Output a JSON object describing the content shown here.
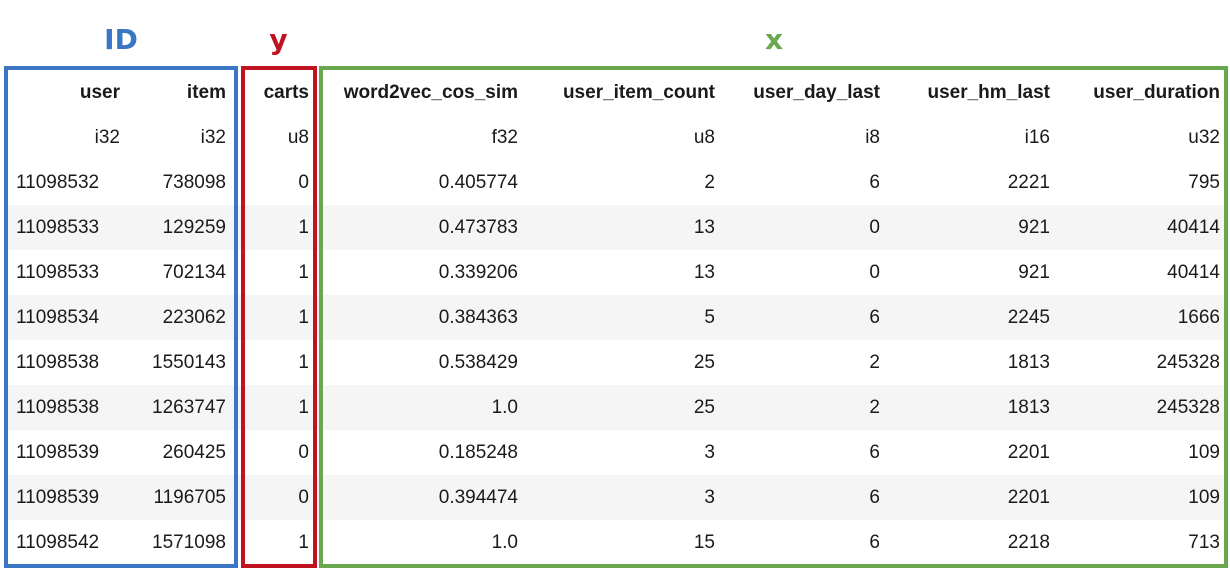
{
  "groups": {
    "id": {
      "label": "ID",
      "color": "#3a76c4"
    },
    "y": {
      "label": "y",
      "color": "#c1121f"
    },
    "x": {
      "label": "x",
      "color": "#6aa84f"
    }
  },
  "columns": [
    "user",
    "item",
    "carts",
    "word2vec_cos_sim",
    "user_item_count",
    "user_day_last",
    "user_hm_last",
    "user_duration"
  ],
  "dtypes": [
    "i32",
    "i32",
    "u8",
    "f32",
    "u8",
    "i8",
    "i16",
    "u32"
  ],
  "rows": [
    [
      "11098532",
      "738098",
      "0",
      "0.405774",
      "2",
      "6",
      "2221",
      "795"
    ],
    [
      "11098533",
      "129259",
      "1",
      "0.473783",
      "13",
      "0",
      "921",
      "40414"
    ],
    [
      "11098533",
      "702134",
      "1",
      "0.339206",
      "13",
      "0",
      "921",
      "40414"
    ],
    [
      "11098534",
      "223062",
      "1",
      "0.384363",
      "5",
      "6",
      "2245",
      "1666"
    ],
    [
      "11098538",
      "1550143",
      "1",
      "0.538429",
      "25",
      "2",
      "1813",
      "245328"
    ],
    [
      "11098538",
      "1263747",
      "1",
      "1.0",
      "25",
      "2",
      "1813",
      "245328"
    ],
    [
      "11098539",
      "260425",
      "0",
      "0.185248",
      "3",
      "6",
      "2201",
      "109"
    ],
    [
      "11098539",
      "1196705",
      "0",
      "0.394474",
      "3",
      "6",
      "2201",
      "109"
    ],
    [
      "11098542",
      "1571098",
      "1",
      "1.0",
      "15",
      "6",
      "2218",
      "713"
    ]
  ]
}
